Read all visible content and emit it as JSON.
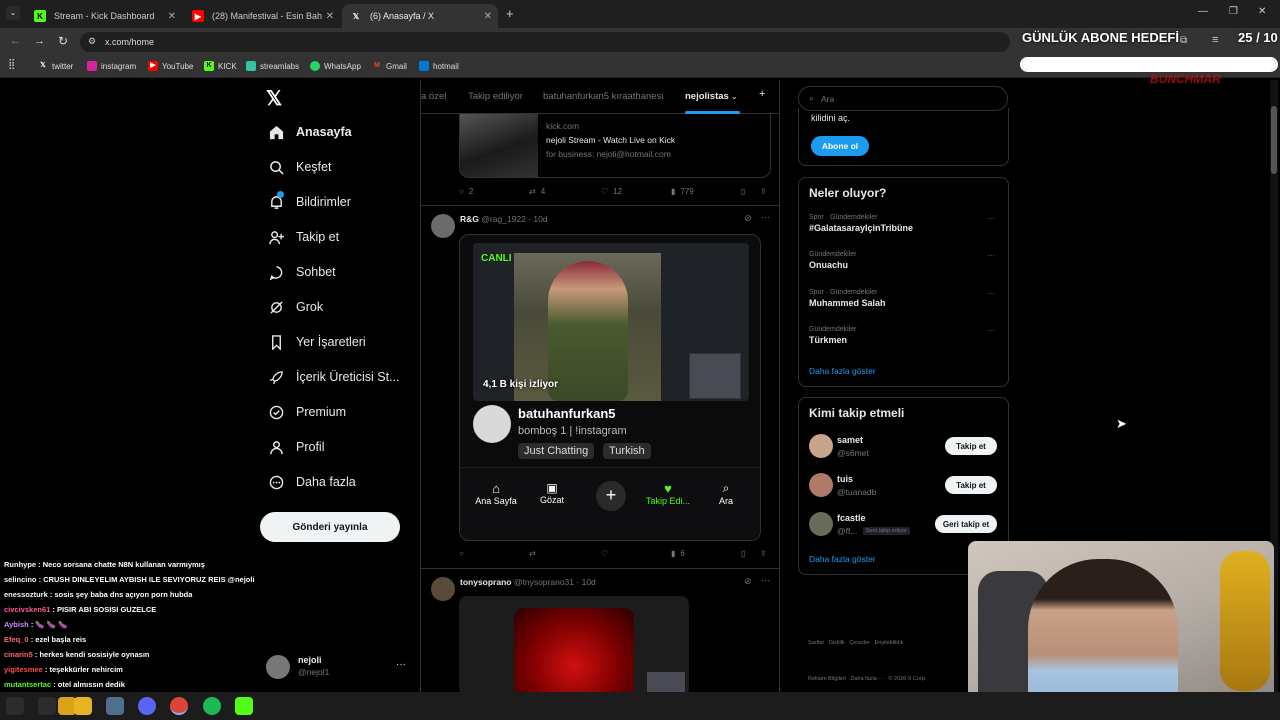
{
  "browser": {
    "tabs": [
      {
        "title": "Stream - Kick Dashboard",
        "icon": "kick-icon"
      },
      {
        "title": "(28) Manifestival - Esin Bahat In",
        "icon": "youtube-icon"
      },
      {
        "title": "(6) Anasayfa / X",
        "icon": "x-icon"
      }
    ],
    "url": "x.com/home",
    "bookmarks": [
      "twitter",
      "instagram",
      "YouTube",
      "KICK",
      "streamlabs",
      "WhatsApp",
      "Gmail",
      "hotmail"
    ]
  },
  "overlay": {
    "goal_title": "GÜNLÜK ABONE HEDEFİ",
    "goal_count": "25 / 10",
    "goal_progress": 1.0,
    "brand_text": "BUNCHMAR"
  },
  "nav": {
    "items": [
      "Anasayfa",
      "Keşfet",
      "Bildirimler",
      "Takip et",
      "Sohbet",
      "Grok",
      "Yer İşaretleri",
      "İçerik Üreticisi St...",
      "Premium",
      "Profil",
      "Daha fazla"
    ],
    "post_button": "Gönderi yayınla",
    "account": {
      "name": "nejoli",
      "handle": "@nejol1"
    }
  },
  "timeline": {
    "tabs": [
      "a özel",
      "Takip ediliyor",
      "batuhanfurkan5 kıraathanesi",
      "nejolistas"
    ],
    "post1": {
      "link_domain": "kick.com",
      "link_title": "nejoli Stream - Watch Live on Kick",
      "link_desc": "for business: nejoli@hotmail.com",
      "replies": "2",
      "reposts": "4",
      "likes": "12",
      "views": "779"
    },
    "post2": {
      "author": "R&G",
      "handle": "@rag_1922",
      "time": "10d",
      "live_label": "CANLI",
      "viewers": "4,1 B kişi izliyor",
      "streamer": "batuhanfurkan5",
      "bio": "bomboş 1 | !instagram",
      "tags": [
        "Just Chatting",
        "Turkish"
      ],
      "bottom_nav": [
        "Ana Sayfa",
        "Gözat",
        "",
        "Takip Edi...",
        "Ara"
      ],
      "views": "6"
    },
    "post3": {
      "author": "tonysoprano",
      "handle": "@tnysoprano31",
      "time": "10d"
    }
  },
  "sidebar": {
    "search_placeholder": "Ara",
    "premium_text": "kilidini aç.",
    "subscribe_button": "Abone ol",
    "trends_title": "Neler oluyor?",
    "trends": [
      {
        "meta": "Spor · Gündemdekiler",
        "name": "#GalatasarayIçinTribüne"
      },
      {
        "meta": "Gündemdekiler",
        "name": "Onuachu"
      },
      {
        "meta": "Spor · Gündemdekiler",
        "name": "Muhammed Salah"
      },
      {
        "meta": "Gündemdekiler",
        "name": "Türkmen"
      }
    ],
    "show_more": "Daha fazla göster",
    "who_title": "Kimi takip etmeli",
    "who": [
      {
        "name": "samet",
        "handle": "@s6met",
        "button": "Takip et"
      },
      {
        "name": "tuis",
        "handle": "@tuanadb",
        "button": "Takip et"
      },
      {
        "name": "fcastle",
        "handle": "@ff...",
        "badge": "Seni takip ediyor",
        "button": "Geri takip et"
      }
    ],
    "show_more2": "Daha fazla göster",
    "footer1": "Şartlar   Gizlilik   Çerezler   Erişilebilirlik",
    "footer2": "Reklam Bilgileri   Daha fazla ···   © 2026 X Corp."
  },
  "chat": [
    {
      "user": "Runhype",
      "msg": "Neco sorsana chatte N8N kullanan varmıymış",
      "color": "#f5f5f5"
    },
    {
      "user": "selincino",
      "msg": "CRUSH DINLEYELIM AYBISH ILE SEVIYORUZ REIS @nejoli",
      "color": "#f5f5f5"
    },
    {
      "user": "enessozturk",
      "msg": "sosis şey baba dns açıyon porn hubda",
      "color": "#f5f5f5"
    },
    {
      "user": "civcivsken61",
      "msg": "PISIR ABI SOSISI GUZELCE",
      "color": "#ff5c8a"
    },
    {
      "user": "Aybish",
      "msg": "🍆 🍆 🍆",
      "color": "#c78cff"
    },
    {
      "user": "Efeq_0",
      "msg": "ezel başla reis",
      "color": "#ff6b6b"
    },
    {
      "user": "cinarin5",
      "msg": "herkes kendi sosisiyle oynasın",
      "color": "#ff6b6b"
    },
    {
      "user": "yigitesmee",
      "msg": "teşekkürler nehircim",
      "color": "#ff4d4d"
    },
    {
      "user": "mutantsertac",
      "msg": "otel almıssın dedik",
      "color": "#53fc18"
    },
    {
      "user": "selincino",
      "msg": "",
      "color": "#f5f5f5"
    }
  ],
  "colors": {
    "accent": "#1d9bf0",
    "kick": "#53fc18",
    "bg": "#000000",
    "border": "#2f3336"
  }
}
